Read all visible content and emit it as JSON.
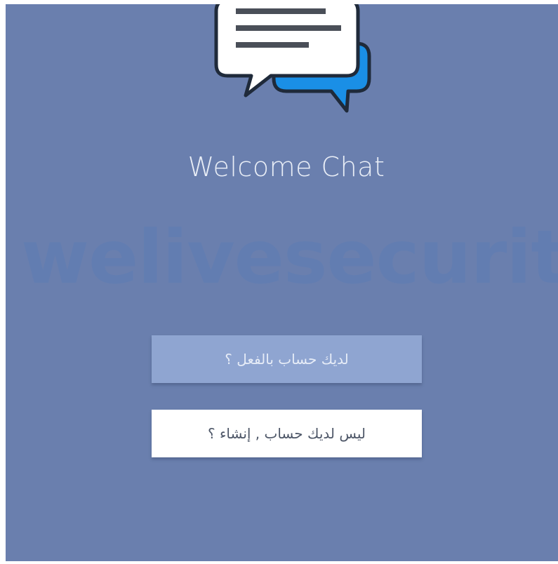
{
  "app": {
    "title": "Welcome Chat",
    "watermark": "welivesecurity"
  },
  "buttons": {
    "login_label": "لديك حساب بالفعل ؟",
    "register_label": "ليس لديك حساب , إنشاء ؟"
  },
  "colors": {
    "background": "#6a7fae",
    "login_button": "#8fa5d1",
    "register_button": "#ffffff",
    "bubble_front": "#ffffff",
    "bubble_back": "#1a8fe6"
  },
  "icons": {
    "logo": "chat-bubbles-icon"
  }
}
